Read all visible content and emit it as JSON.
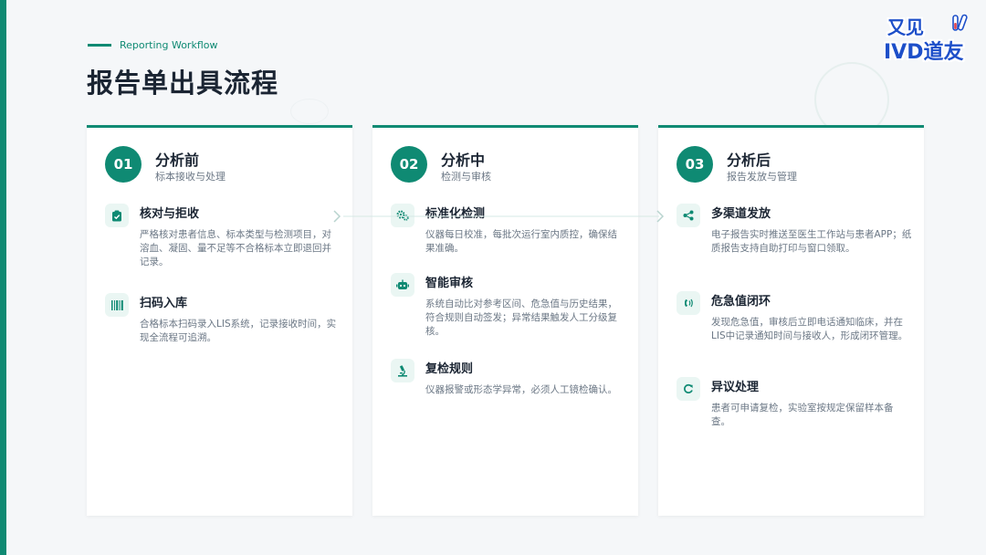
{
  "header": {
    "subtitle": "Reporting Workflow",
    "title": "报告单出具流程"
  },
  "logo": {
    "line1": "又见",
    "line2": "IVD道友"
  },
  "colors": {
    "accent": "#0f8a73",
    "logo_blue": "#1d4fc9"
  },
  "stages": [
    {
      "number": "01",
      "title": "分析前",
      "subtitle": "标本接收与处理",
      "items": [
        {
          "icon": "clipboard-check-icon",
          "title": "核对与拒收",
          "desc": "严格核对患者信息、标本类型与检测项目，对溶血、凝固、量不足等不合格标本立即退回并记录。"
        },
        {
          "icon": "barcode-icon",
          "title": "扫码入库",
          "desc": "合格标本扫码录入LIS系统，记录接收时间，实现全流程可追溯。"
        }
      ]
    },
    {
      "number": "02",
      "title": "分析中",
      "subtitle": "检测与审核",
      "items": [
        {
          "icon": "gears-icon",
          "title": "标准化检测",
          "desc": "仪器每日校准，每批次运行室内质控，确保结果准确。"
        },
        {
          "icon": "robot-icon",
          "title": "智能审核",
          "desc": "系统自动比对参考区间、危急值与历史结果，符合规则自动签发；异常结果触发人工分级复核。"
        },
        {
          "icon": "microscope-icon",
          "title": "复检规则",
          "desc": "仪器报警或形态学异常，必须人工镜检确认。"
        }
      ]
    },
    {
      "number": "03",
      "title": "分析后",
      "subtitle": "报告发放与管理",
      "items": [
        {
          "icon": "share-icon",
          "title": "多渠道发放",
          "desc": "电子报告实时推送至医生工作站与患者APP；纸质报告支持自助打印与窗口领取。"
        },
        {
          "icon": "phone-volume-icon",
          "title": "危急值闭环",
          "desc": "发现危急值，审核后立即电话通知临床，并在LIS中记录通知时间与接收人，形成闭环管理。"
        },
        {
          "icon": "redo-icon",
          "title": "异议处理",
          "desc": "患者可申请复检，实验室按规定保留样本备查。"
        }
      ]
    }
  ]
}
